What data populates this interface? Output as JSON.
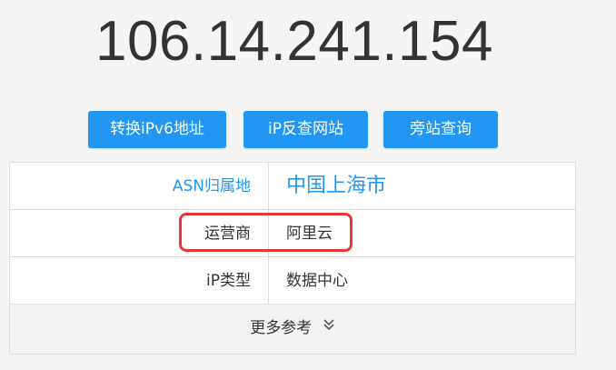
{
  "ip_address": "106.14.241.154",
  "buttons": {
    "ipv6": "转换iPv6地址",
    "reverse_lookup": "iP反查网站",
    "side_sites": "旁站查询"
  },
  "info": {
    "asn_location_label": "ASN归属地",
    "asn_location_value": "中国上海市",
    "isp_label": "运营商",
    "isp_value": "阿里云",
    "ip_type_label": "iP类型",
    "ip_type_value": "数据中心"
  },
  "more": {
    "label": "更多参考",
    "icon": "double-chevron-down-icon"
  },
  "colors": {
    "accent": "#2196f3",
    "highlight": "#e5383b",
    "text": "#333333"
  }
}
